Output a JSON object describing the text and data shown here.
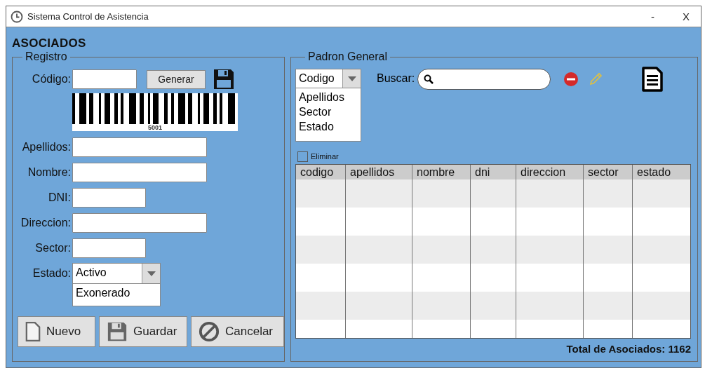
{
  "window": {
    "title": "Sistema Control de Asistencia",
    "minimize": "-",
    "close": "X"
  },
  "heading": "ASOCIADOS",
  "registro": {
    "legend": "Registro",
    "codigo": {
      "label": "Código:",
      "generate_button": "Generar",
      "barcode_number": "5001"
    },
    "fields": [
      {
        "label": "Apellidos:"
      },
      {
        "label": "Nombre:"
      },
      {
        "label": "DNI:"
      },
      {
        "label": "Direccion:"
      },
      {
        "label": "Sector:"
      }
    ],
    "estado": {
      "label": "Estado:",
      "value": "Activo",
      "options": [
        "Exonerado"
      ]
    },
    "buttons": [
      "Nuevo",
      "Guardar",
      "Cancelar"
    ]
  },
  "padron": {
    "legend": "Padron General",
    "filter": {
      "value": "Codigo",
      "options": [
        "Apellidos",
        "Sector",
        "Estado"
      ]
    },
    "search": {
      "label": "Buscar:"
    },
    "eliminar": {
      "label": "Eliminar",
      "checked": false
    },
    "table": {
      "columns": [
        "codigo",
        "apellidos",
        "nombre",
        "dni",
        "direccion",
        "sector",
        "estado"
      ]
    },
    "total": "Total de Asociados: 1162"
  }
}
